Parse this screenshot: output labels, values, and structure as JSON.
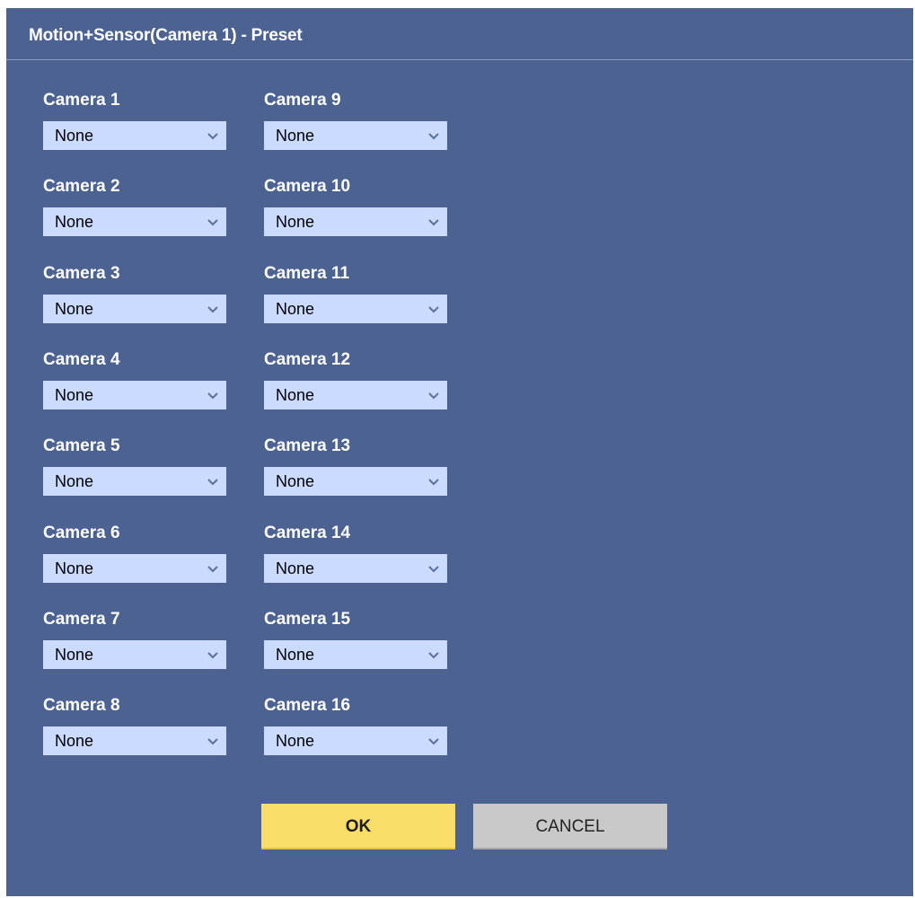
{
  "dialog": {
    "title": "Motion+Sensor(Camera 1) - Preset"
  },
  "columns": [
    {
      "cameras": [
        {
          "label": "Camera 1",
          "value": "None"
        },
        {
          "label": "Camera 2",
          "value": "None"
        },
        {
          "label": "Camera 3",
          "value": "None"
        },
        {
          "label": "Camera 4",
          "value": "None"
        },
        {
          "label": "Camera 5",
          "value": "None"
        },
        {
          "label": "Camera 6",
          "value": "None"
        },
        {
          "label": "Camera 7",
          "value": "None"
        },
        {
          "label": "Camera 8",
          "value": "None"
        }
      ]
    },
    {
      "cameras": [
        {
          "label": "Camera 9",
          "value": "None"
        },
        {
          "label": "Camera 10",
          "value": "None"
        },
        {
          "label": "Camera 11",
          "value": "None"
        },
        {
          "label": "Camera 12",
          "value": "None"
        },
        {
          "label": "Camera 13",
          "value": "None"
        },
        {
          "label": "Camera 14",
          "value": "None"
        },
        {
          "label": "Camera 15",
          "value": "None"
        },
        {
          "label": "Camera 16",
          "value": "None"
        }
      ]
    }
  ],
  "buttons": {
    "ok_label": "OK",
    "cancel_label": "CANCEL"
  },
  "icons": {
    "dropdown": "chevron-down-icon"
  },
  "colors": {
    "dialog_background": "#4c6392",
    "select_background": "#cbdaff",
    "ok_button": "#fbdd6a",
    "cancel_button": "#c9c9c9"
  }
}
